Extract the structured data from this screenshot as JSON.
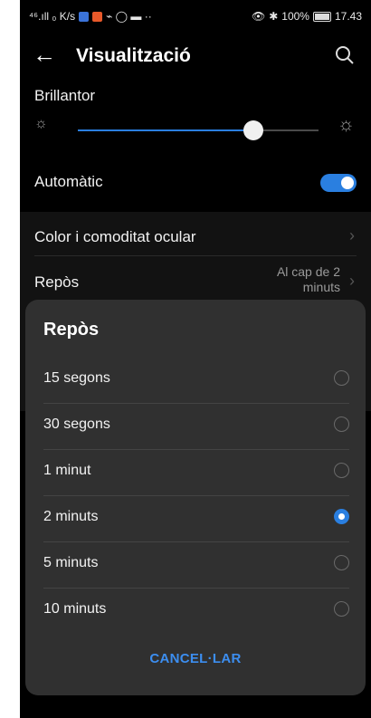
{
  "status_bar": {
    "left_text": "⁴⁶.ıll ₀ K/s",
    "battery": "100%",
    "time": "17.43"
  },
  "app_bar": {
    "title": "Visualització"
  },
  "brightness": {
    "label": "Brillantor",
    "level": 0.73
  },
  "automatic": {
    "label": "Automàtic",
    "on": true
  },
  "settings": {
    "color_label": "Color i comoditat ocular",
    "sleep_label": "Repòs",
    "sleep_value": "Al cap de 2 minuts"
  },
  "dialog": {
    "title": "Repòs",
    "options": [
      {
        "label": "15 segons",
        "selected": false
      },
      {
        "label": "30 segons",
        "selected": false
      },
      {
        "label": "1 minut",
        "selected": false
      },
      {
        "label": "2 minuts",
        "selected": true
      },
      {
        "label": "5 minuts",
        "selected": false
      },
      {
        "label": "10 minuts",
        "selected": false
      }
    ],
    "cancel_label": "CANCEL·LAR"
  },
  "colors": {
    "accent": "#2a7fe0",
    "dialog_bg": "#303030",
    "background": "#000000"
  },
  "icons": [
    "back-arrow-icon",
    "search-icon",
    "sun-small-icon",
    "sun-large-icon",
    "chevron-right-icon"
  ]
}
